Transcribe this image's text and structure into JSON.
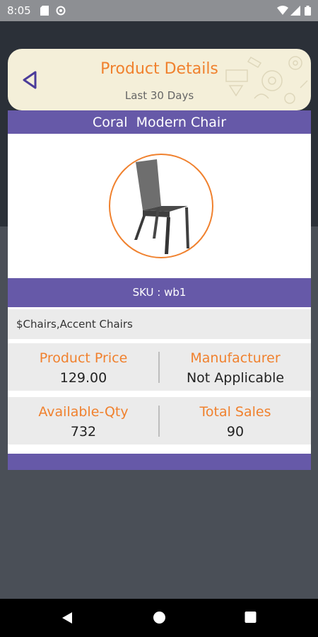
{
  "status_bar": {
    "time": "8:05"
  },
  "header": {
    "title": "Product Details",
    "subtitle": "Last 30 Days"
  },
  "product": {
    "name": "Coral  Modern Chair",
    "sku": "SKU : wb1",
    "categories": "$Chairs,Accent Chairs",
    "price_label": "Product Price",
    "price_value": "129.00",
    "manufacturer_label": "Manufacturer",
    "manufacturer_value": "Not Applicable",
    "qty_label": "Available-Qty",
    "qty_value": "732",
    "sales_label": "Total Sales",
    "sales_value": "90"
  },
  "colors": {
    "accent": "#f0812e",
    "brand_purple": "#6659a8",
    "header_bg": "#f4efd9"
  },
  "icons": {
    "back": "back-triangle-icon",
    "nav_back": "nav-back-icon",
    "nav_home": "nav-home-icon",
    "nav_recents": "nav-recents-icon"
  }
}
